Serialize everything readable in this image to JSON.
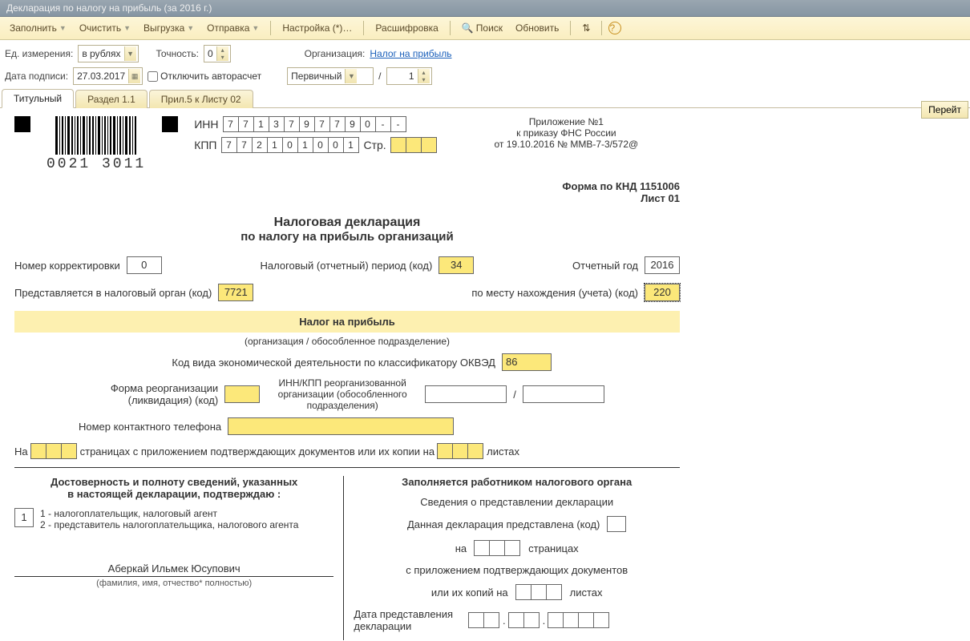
{
  "title": "Декларация по налогу на прибыль (за 2016 г.)",
  "toolbar": {
    "fill": "Заполнить",
    "clear": "Очистить",
    "upload": "Выгрузка",
    "send": "Отправка",
    "settings": "Настройка (*)…",
    "decode": "Расшифровка",
    "search": "Поиск",
    "refresh": "Обновить"
  },
  "params": {
    "unit_label": "Ед. измерения:",
    "unit_value": "в рублях",
    "precision_label": "Точность:",
    "precision_value": "0",
    "org_label": "Организация:",
    "org_link": "Налог на прибыль",
    "date_label": "Дата подписи:",
    "date_value": "27.03.2017",
    "autocalc": "Отключить авторасчет",
    "doctype": "Первичный",
    "slash": "/",
    "pageno": "1",
    "go": "Перейт"
  },
  "tabs": {
    "t1": "Титульный",
    "t2": "Раздел 1.1",
    "t3": "Прил.5 к Листу 02"
  },
  "inn_label": "ИНН",
  "inn": [
    "7",
    "7",
    "1",
    "3",
    "7",
    "9",
    "7",
    "7",
    "9",
    "0",
    "-",
    "-"
  ],
  "kpp_label": "КПП",
  "kpp": [
    "7",
    "7",
    "2",
    "1",
    "0",
    "1",
    "0",
    "0",
    "1"
  ],
  "page_label": "Стр.",
  "barcode": "0021 3011",
  "appendix": {
    "l1": "Приложение №1",
    "l2": "к приказу ФНС России",
    "l3": "от 19.10.2016 № ММВ-7-3/572@"
  },
  "formcode": {
    "l1": "Форма по КНД 1151006",
    "l2": "Лист 01"
  },
  "main_title1": "Налоговая декларация",
  "main_title2": "по налогу на прибыль организаций",
  "corr_label": "Номер корректировки",
  "corr_val": "0",
  "period_label": "Налоговый (отчетный) период (код)",
  "period_val": "34",
  "year_label": "Отчетный год",
  "year_val": "2016",
  "organ_label": "Представляется в налоговый орган (код)",
  "organ_val": "7721",
  "place_label": "по месту нахождения (учета) (код)",
  "place_val": "220",
  "band": "Налог на прибыль",
  "band_sub": "(организация / обособленное подразделение)",
  "okved_label": "Код вида экономической деятельности по классификатору ОКВЭД",
  "okved_val": "86",
  "reorg_label1": "Форма реорганизации",
  "reorg_label2": "(ликвидация) (код)",
  "reorg_inn1": "ИНН/КПП реорганизованной",
  "reorg_inn2": "организации (обособленного",
  "reorg_inn3": "подразделения)",
  "phone_label": "Номер контактного телефона",
  "pages1": "На",
  "pages2": "страницах с приложением подтверждающих документов или их копии на",
  "pages3": "листах",
  "left_hdr1": "Достоверность и полноту сведений, указанных",
  "left_hdr2": "в настоящей декларации, подтверждаю :",
  "signer_box": "1",
  "signer1": "1 - налогоплательщик, налоговый агент",
  "signer2": "2 - представитель налогоплательщика, налогового агента",
  "fio": "Аберкай Ильмек Юсупович",
  "fio_cap": "(фамилия, имя, отчество* полностью)",
  "right_hdr": "Заполняется работником налогового органа",
  "r_sub": "Сведения о представлении декларации",
  "r1": "Данная декларация представлена  (код)",
  "r2a": "на",
  "r2b": "страницах",
  "r3": "с приложением подтверждающих документов",
  "r4a": "или их копий на",
  "r4b": "листах",
  "r5a": "Дата представления",
  "r5b": "декларации"
}
